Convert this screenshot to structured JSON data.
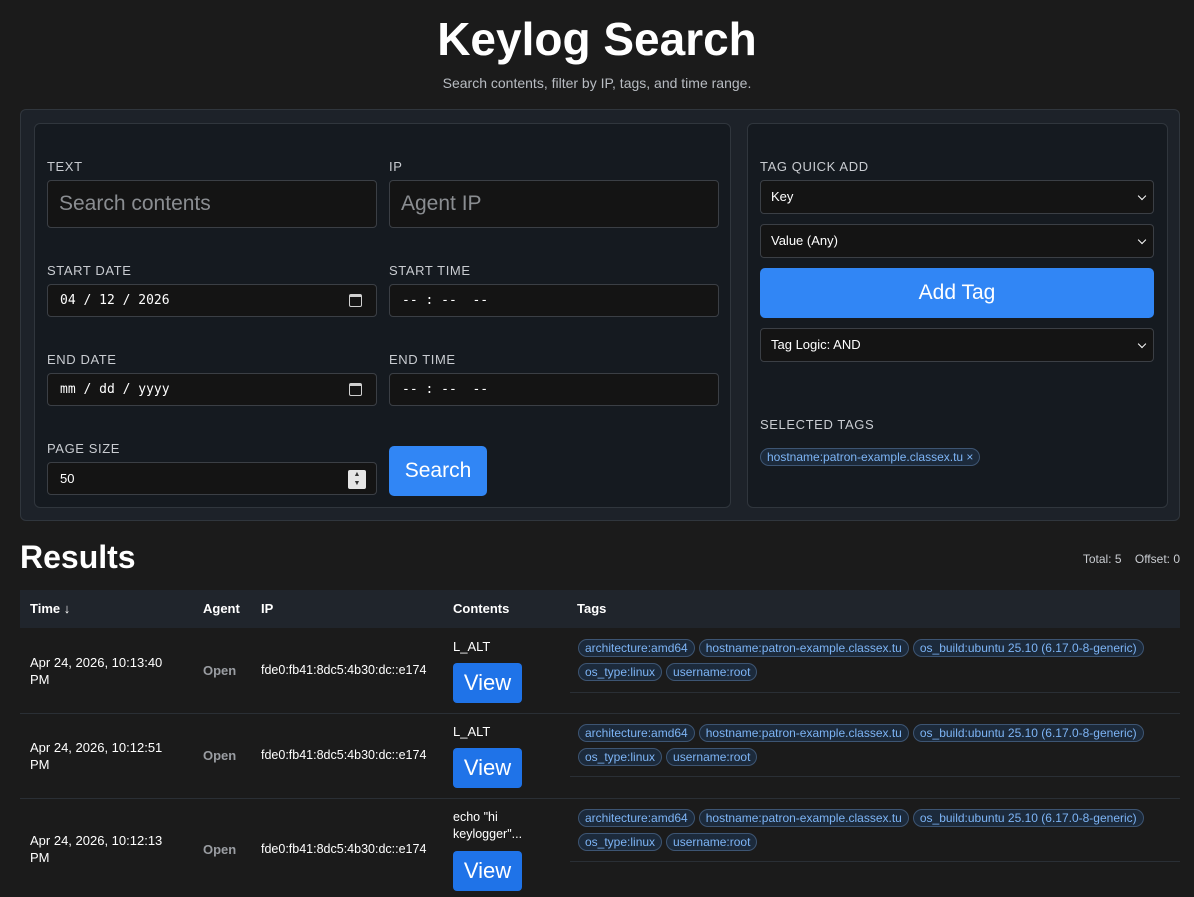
{
  "header": {
    "title": "Keylog Search",
    "subtitle": "Search contents, filter by IP, tags, and time range."
  },
  "form": {
    "text_label": "TEXT",
    "text_placeholder": "Search contents",
    "ip_label": "IP",
    "ip_placeholder": "Agent IP",
    "start_date_label": "START DATE",
    "start_date_value": "04 / 12 / 2026",
    "start_time_label": "START TIME",
    "start_time_value": "-- : --  --",
    "end_date_label": "END DATE",
    "end_date_value": "mm / dd / yyyy",
    "end_time_label": "END TIME",
    "end_time_value": "-- : --  --",
    "page_size_label": "PAGE SIZE",
    "page_size_value": "50",
    "search_button": "Search"
  },
  "tag_panel": {
    "quick_add_label": "TAG QUICK ADD",
    "key_select": "Key",
    "value_select": "Value (Any)",
    "add_button": "Add Tag",
    "logic_select": "Tag Logic: AND",
    "selected_label": "SELECTED TAGS",
    "selected_tags": [
      "hostname:patron-example.classex.tu ×"
    ]
  },
  "results": {
    "title": "Results",
    "total": "Total: 5",
    "offset": "Offset: 0",
    "columns": [
      "Time ↓",
      "Agent",
      "IP",
      "Contents",
      "Tags"
    ],
    "view_label": "View",
    "rows": [
      {
        "time": "Apr 24, 2026, 10:13:40 PM",
        "agent": "Open",
        "ip": "fde0:fb41:8dc5:4b30:dc::e174",
        "contents": "L_ALT",
        "tags": [
          "architecture:amd64",
          "hostname:patron-example.classex.tu",
          "os_build:ubuntu 25.10 (6.17.0-8-generic)",
          "os_type:linux",
          "username:root"
        ]
      },
      {
        "time": "Apr 24, 2026, 10:12:51 PM",
        "agent": "Open",
        "ip": "fde0:fb41:8dc5:4b30:dc::e174",
        "contents": "L_ALT",
        "tags": [
          "architecture:amd64",
          "hostname:patron-example.classex.tu",
          "os_build:ubuntu 25.10 (6.17.0-8-generic)",
          "os_type:linux",
          "username:root"
        ]
      },
      {
        "time": "Apr 24, 2026, 10:12:13 PM",
        "agent": "Open",
        "ip": "fde0:fb41:8dc5:4b30:dc::e174",
        "contents": "echo \"hi keylogger\"...",
        "tags": [
          "architecture:amd64",
          "hostname:patron-example.classex.tu",
          "os_build:ubuntu 25.10 (6.17.0-8-generic)",
          "os_type:linux",
          "username:root"
        ]
      }
    ]
  },
  "colors": {
    "background": "#1b1b1b",
    "accent": "#3186f5",
    "tag_text": "#7db4f5"
  }
}
